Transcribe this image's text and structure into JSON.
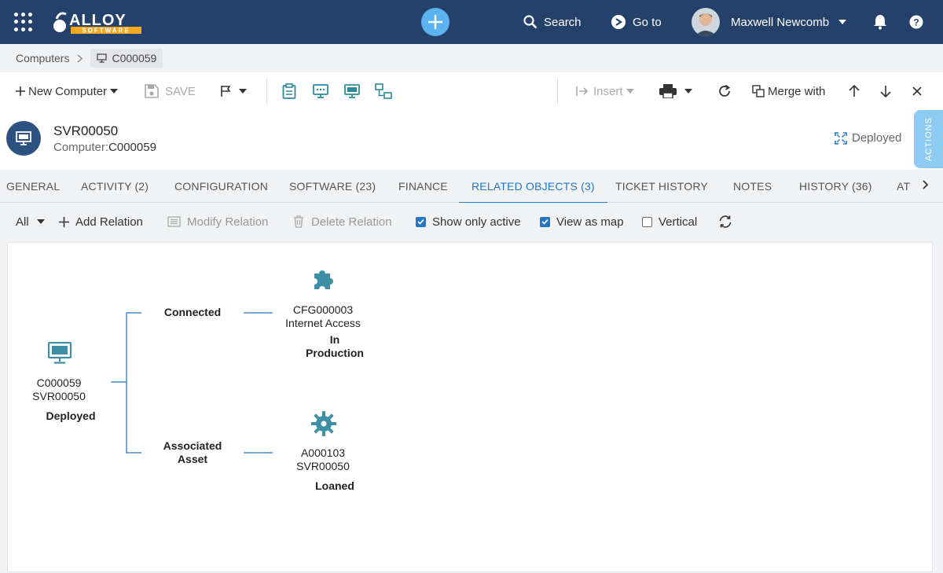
{
  "app": {
    "logo_text_top": "ALLOY",
    "logo_text_bottom": "SOFTWARE",
    "search_label": "Search",
    "goto_label": "Go to",
    "user_name": "Maxwell Newcomb"
  },
  "breadcrumb": {
    "root": "Computers",
    "current": "C000059"
  },
  "toolbar": {
    "new_label": "New Computer",
    "save_label": "SAVE",
    "insert_label": "Insert",
    "merge_label": "Merge with"
  },
  "record": {
    "title": "SVR00050",
    "type_label": "Computer:",
    "id": "C000059",
    "status": "Deployed",
    "actions_label": "ACTIONS"
  },
  "tabs": [
    {
      "label": "GENERAL"
    },
    {
      "label": "ACTIVITY (2)"
    },
    {
      "label": "CONFIGURATION"
    },
    {
      "label": "SOFTWARE (23)"
    },
    {
      "label": "FINANCE"
    },
    {
      "label": "RELATED OBJECTS (3)"
    },
    {
      "label": "TICKET HISTORY"
    },
    {
      "label": "NOTES"
    },
    {
      "label": "HISTORY (36)"
    },
    {
      "label": "AT"
    }
  ],
  "subbar": {
    "filter_label": "All",
    "add_label": "Add Relation",
    "modify_label": "Modify Relation",
    "delete_label": "Delete Relation",
    "show_active_label": "Show only active",
    "view_map_label": "View as map",
    "vertical_label": "Vertical"
  },
  "map": {
    "root": {
      "id": "C000059",
      "name": "SVR00050",
      "status": "Deployed"
    },
    "relations": [
      {
        "type_line1": "Connected",
        "type_line2": "",
        "id": "CFG000003",
        "name": "Internet Access",
        "status_line1": "In",
        "status_line2": "Production"
      },
      {
        "type_line1": "Associated",
        "type_line2": "Asset",
        "id": "A000103",
        "name": "SVR00050",
        "status_line1": "Loaned",
        "status_line2": ""
      }
    ]
  },
  "colors": {
    "topbar": "#23416b",
    "accent": "#2176c7",
    "map_icon": "#3e8fa3",
    "add_button": "#5bb3f0"
  }
}
